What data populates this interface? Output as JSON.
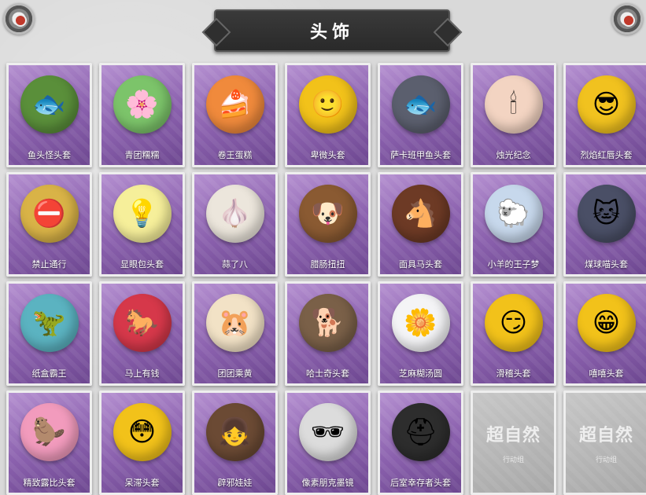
{
  "title": "头饰",
  "items": [
    {
      "name": "鱼头怪头套",
      "icon": "fish-head-icon",
      "glyph": "🐟",
      "color": "#5a8f3a",
      "locked": false
    },
    {
      "name": "青团糯糯",
      "icon": "green-dumpling-icon",
      "glyph": "🌸",
      "color": "#7cc46a",
      "locked": false
    },
    {
      "name": "卷王蛋糕",
      "icon": "roll-cake-icon",
      "glyph": "🍰",
      "color": "#f08a3c",
      "locked": false
    },
    {
      "name": "卑微头套",
      "icon": "sad-smiley-icon",
      "glyph": "🙂",
      "color": "#f2c21a",
      "locked": false
    },
    {
      "name": "萨卡班甲鱼头套",
      "icon": "sacabambaspis-icon",
      "glyph": "🐟",
      "color": "#5b5f6e",
      "locked": false
    },
    {
      "name": "烛光纪念",
      "icon": "candle-icon",
      "glyph": "🕯",
      "color": "#f3d4c2",
      "locked": false
    },
    {
      "name": "烈焰红唇头套",
      "icon": "yellow-mask-icon",
      "glyph": "😎",
      "color": "#f1c21f",
      "locked": false
    },
    {
      "name": "禁止通行",
      "icon": "no-entry-icon",
      "glyph": "⛔",
      "color": "#d9b347",
      "locked": false
    },
    {
      "name": "显眼包头套",
      "icon": "lightbulb-icon",
      "glyph": "💡",
      "color": "#f6ef9a",
      "locked": false
    },
    {
      "name": "蒜了八",
      "icon": "garlic-icon",
      "glyph": "🧄",
      "color": "#ece6dc",
      "locked": false
    },
    {
      "name": "腊肠扭扭",
      "icon": "dog-head-icon",
      "glyph": "🐶",
      "color": "#8a5a32",
      "locked": false
    },
    {
      "name": "面具马头套",
      "icon": "horse-head-icon",
      "glyph": "🐴",
      "color": "#6d3a25",
      "locked": false
    },
    {
      "name": "小羊的王子梦",
      "icon": "sheep-crown-icon",
      "glyph": "🐑",
      "color": "#c7d8ec",
      "locked": false
    },
    {
      "name": "煤球喵头套",
      "icon": "cat-head-icon",
      "glyph": "🐱",
      "color": "#4a4f66",
      "locked": false
    },
    {
      "name": "纸盒霸王",
      "icon": "dinosaur-box-icon",
      "glyph": "🦖",
      "color": "#5bb3c1",
      "locked": false
    },
    {
      "name": "马上有钱",
      "icon": "red-horse-icon",
      "glyph": "🐎",
      "color": "#d6384a",
      "locked": false
    },
    {
      "name": "团团乘黄",
      "icon": "fluffy-beast-icon",
      "glyph": "🐹",
      "color": "#f2e2c6",
      "locked": false
    },
    {
      "name": "哈士奇头套",
      "icon": "husky-sunglasses-icon",
      "glyph": "🐕",
      "color": "#7a6048",
      "locked": false
    },
    {
      "name": "芝麻糊汤圆",
      "icon": "dumpling-flower-icon",
      "glyph": "🌼",
      "color": "#f4f4f6",
      "locked": false
    },
    {
      "name": "滑稽头套",
      "icon": "funny-smiley-icon",
      "glyph": "😏",
      "color": "#f2c21a",
      "locked": false
    },
    {
      "name": "嘻嘻头套",
      "icon": "grin-smiley-icon",
      "glyph": "😁",
      "color": "#f2c21a",
      "locked": false
    },
    {
      "name": "精致露比头套",
      "icon": "pink-beaver-icon",
      "glyph": "🦫",
      "color": "#f29bbd",
      "locked": false
    },
    {
      "name": "呆滞头套",
      "icon": "stare-smiley-icon",
      "glyph": "😳",
      "color": "#f2c21a",
      "locked": false
    },
    {
      "name": "辟邪娃娃",
      "icon": "doll-head-icon",
      "glyph": "👧",
      "color": "#6b4a34",
      "locked": false
    },
    {
      "name": "像素朋克墨镜",
      "icon": "pixel-sunglasses-icon",
      "glyph": "🕶",
      "color": "#dcdcdc",
      "locked": false
    },
    {
      "name": "后室幸存者头套",
      "icon": "gas-mask-helmet-icon",
      "glyph": "⛑",
      "color": "#2d2d2d",
      "locked": false
    },
    {
      "name": "",
      "icon": "locked-placeholder-icon",
      "glyph": "",
      "color": "#b7b7b7",
      "locked": true,
      "lock_title": "超自然",
      "lock_sub": "行动组"
    },
    {
      "name": "",
      "icon": "locked-placeholder-icon",
      "glyph": "",
      "color": "#b7b7b7",
      "locked": true,
      "lock_title": "超自然",
      "lock_sub": "行动组"
    }
  ]
}
